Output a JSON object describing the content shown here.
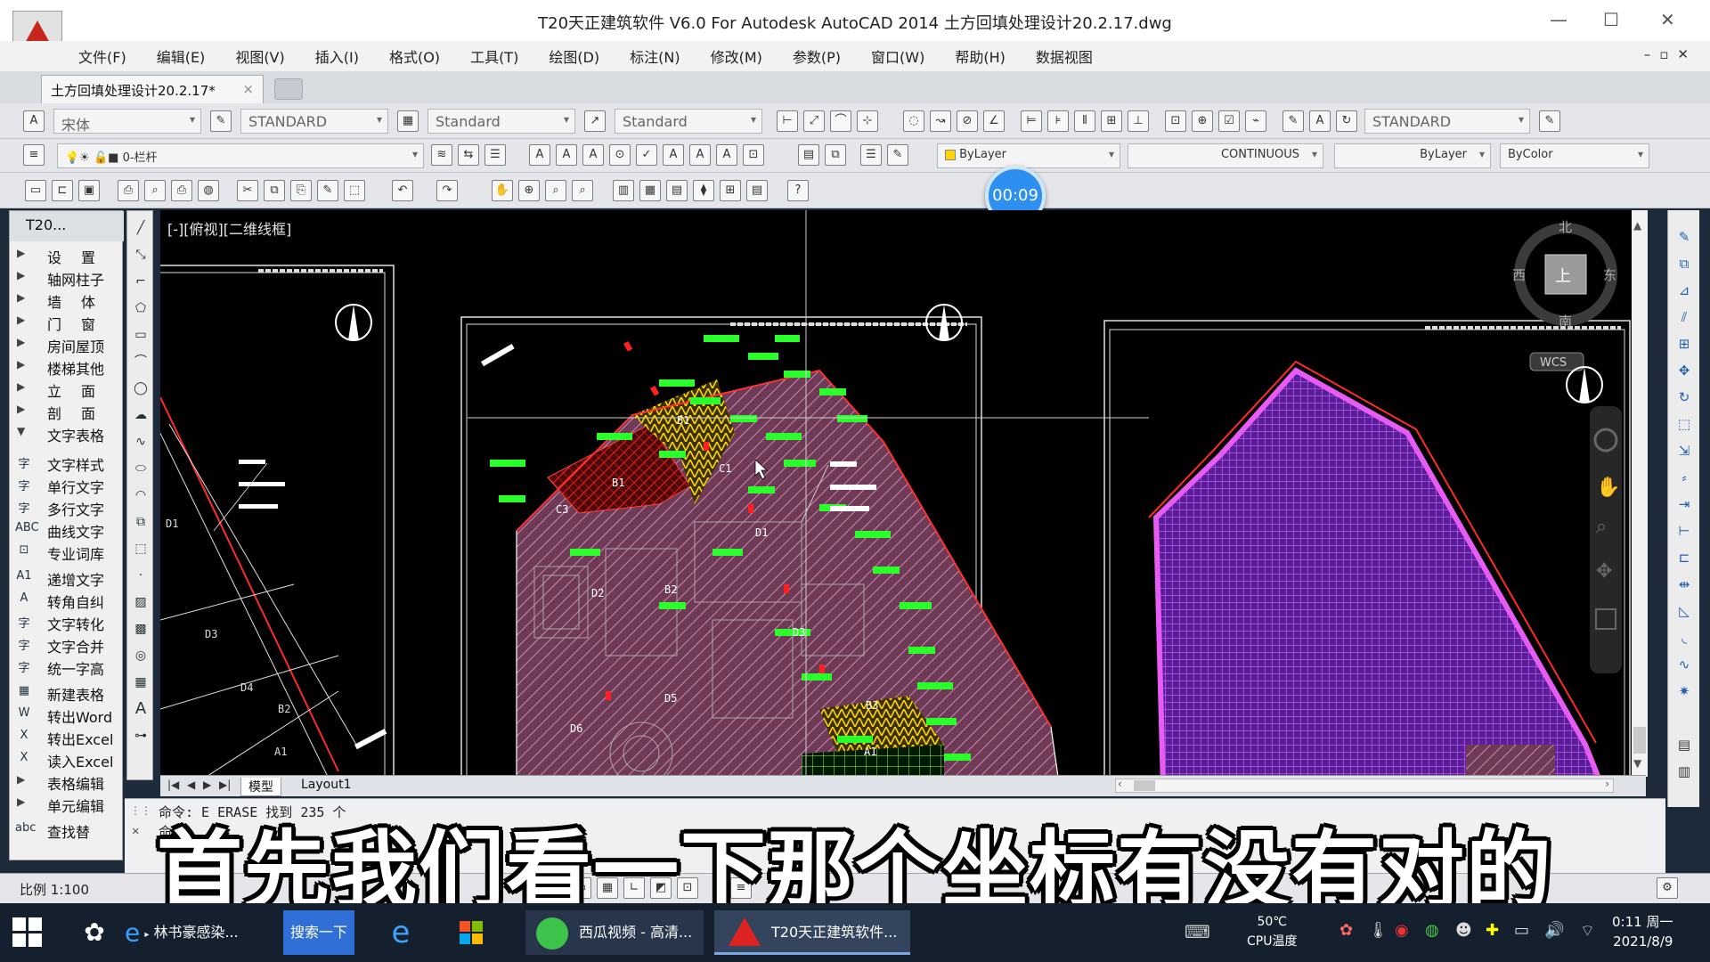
{
  "window": {
    "title": "T20天正建筑软件 V6.0 For Autodesk AutoCAD 2014      土方回填处理设计20.2.17.dwg"
  },
  "menu": [
    "文件(F)",
    "编辑(E)",
    "视图(V)",
    "插入(I)",
    "格式(O)",
    "工具(T)",
    "绘图(D)",
    "标注(N)",
    "修改(M)",
    "参数(P)",
    "窗口(W)",
    "帮助(H)",
    "数据视图"
  ],
  "doc_tab": {
    "label": "土方回填处理设计20.2.17*",
    "close": "×"
  },
  "toolbar": {
    "font": "宋体",
    "text_style": "STANDARD",
    "table_style": "Standard",
    "multileader_style": "Standard",
    "dim_style": "STANDARD",
    "layer": "0-栏杆",
    "color": "ByLayer",
    "linetype": "CONTINUOUS",
    "lineweight": "ByLayer",
    "plotstyle": "ByColor"
  },
  "timer": "00:09",
  "left_panel": {
    "title": "T20...",
    "groups": [
      {
        "label": "设置",
        "spread": true,
        "icon": "arrow"
      },
      {
        "label": "轴网柱子",
        "icon": "arrow"
      },
      {
        "label": "墙体",
        "spread": true,
        "icon": "arrow"
      },
      {
        "label": "门窗",
        "spread": true,
        "icon": "arrow"
      },
      {
        "label": "房间屋顶",
        "icon": "arrow"
      },
      {
        "label": "楼梯其他",
        "icon": "arrow"
      },
      {
        "label": "立面",
        "spread": true,
        "icon": "arrow"
      },
      {
        "label": "剖面",
        "spread": true,
        "icon": "arrow"
      },
      {
        "label": "文字表格",
        "icon": "arrow-open"
      },
      {
        "label": "文字样式",
        "icon": "text-style-icon",
        "glyph": "字"
      },
      {
        "label": "单行文字",
        "icon": "single-line-text-icon",
        "glyph": "字"
      },
      {
        "label": "多行文字",
        "icon": "multiline-text-icon",
        "glyph": "字"
      },
      {
        "label": "曲线文字",
        "icon": "curve-text-icon",
        "glyph": "ABC"
      },
      {
        "label": "专业词库",
        "icon": "word-library-icon",
        "glyph": "⊡"
      },
      {
        "label": "递增文字",
        "icon": "increment-text-icon",
        "glyph": "A1"
      },
      {
        "label": "转角自纠",
        "icon": "rotate-text-icon",
        "glyph": "A"
      },
      {
        "label": "文字转化",
        "icon": "text-convert-icon",
        "glyph": "字"
      },
      {
        "label": "文字合并",
        "icon": "text-merge-icon",
        "glyph": "字"
      },
      {
        "label": "统一字高",
        "icon": "text-height-icon",
        "glyph": "字"
      },
      {
        "label": "新建表格",
        "icon": "new-table-icon",
        "glyph": "▦"
      },
      {
        "label": "转出Word",
        "icon": "word-export-icon",
        "glyph": "W"
      },
      {
        "label": "转出Excel",
        "icon": "excel-export-icon",
        "glyph": "X"
      },
      {
        "label": "读入Excel",
        "icon": "excel-import-icon",
        "glyph": "X"
      },
      {
        "label": "表格编辑",
        "icon": "arrow"
      },
      {
        "label": "单元编辑",
        "icon": "arrow"
      },
      {
        "label": "查找替",
        "icon": "find-replace-icon",
        "glyph": "abc"
      }
    ]
  },
  "viewport": {
    "label": "[-][俯视][二维线框]",
    "compass": {
      "north": "北",
      "south": "南",
      "east": "东",
      "west": "西",
      "top": "上"
    },
    "ucs": "WCS",
    "plan_labels": [
      "D1",
      "D3",
      "D4",
      "B2",
      "A1",
      "B1",
      "C1",
      "C3",
      "D1",
      "D2",
      "B2",
      "D3",
      "D5",
      "D6",
      "B3",
      "A1"
    ]
  },
  "layout_tabs": [
    "模型",
    "Layout1"
  ],
  "command_line": {
    "line1": "命令: E ERASE 找到 235 个",
    "line2": "命令: "
  },
  "status": {
    "scale": "比例 1:100"
  },
  "subtitle": "首先我们看一下那个坐标有没有对的",
  "taskbar": {
    "ie_label": "林书豪感染...",
    "search_label": "搜索一下",
    "xigua_label": "西瓜视频 - 高清...",
    "t20_label": "T20天正建筑软件...",
    "temp_value": "50℃",
    "temp_label": "CPU温度",
    "time": "0:11 周一",
    "date": "2021/8/9"
  }
}
